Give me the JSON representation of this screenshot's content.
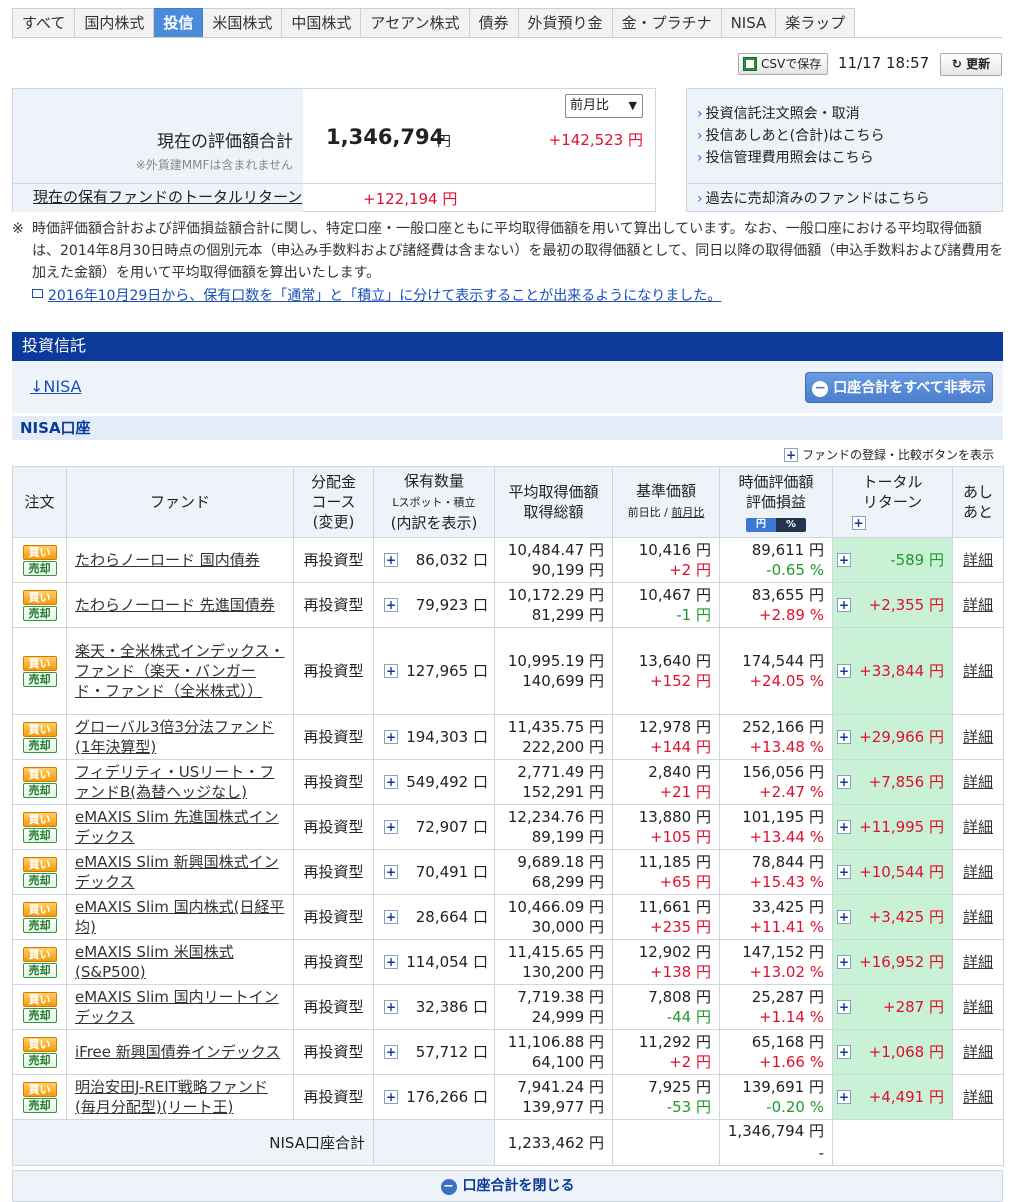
{
  "tabs": [
    "すべて",
    "国内株式",
    "投信",
    "米国株式",
    "中国株式",
    "アセアン株式",
    "債券",
    "外貨預り金",
    "金・プラチナ",
    "NISA",
    "楽ラップ"
  ],
  "active_tab": 2,
  "toolbar": {
    "csv_label": "CSVで保存",
    "datetime": "11/17 18:57",
    "refresh_label": "更新"
  },
  "summary": {
    "label": "現在の評価額合計",
    "note": "※外貨建MMFは含まれません",
    "value": "1,346,794",
    "unit": "円",
    "compare_select": "前月比",
    "diff": "+142,523 円",
    "total_return_label": "現在の保有ファンドのトータルリターン",
    "total_return_value": "+122,194 円"
  },
  "links": [
    "投資信託注文照会・取消",
    "投信あしあと(合計)はこちら",
    "投信管理費用照会はこちら",
    "過去に売却済みのファンドはこちら"
  ],
  "note": {
    "mark": "※",
    "text": "時価評価額合計および評価損益額合計に関し、特定口座・一般口座ともに平均取得価額を用いて算出しています。なお、一般口座における平均取得価額は、2014年8月30日時点の個別元本（申込み手数料および諸経費は含まない）を最初の取得価額として、同日以降の取得価額（申込手数料および諸費用を加えた金額）を用いて平均取得価額を算出いたします。",
    "link": "2016年10月29日から、保有口数を「通常」と「積立」に分けて表示することが出来るようになりました。"
  },
  "section_title": "投資信託",
  "nisa_link": "↓NISA",
  "hide_all_label": "口座合計をすべて非表示",
  "account_header": "NISA口座",
  "register_label": "ファンドの登録・比較ボタンを表示",
  "table": {
    "headers": {
      "order": "注文",
      "fund": "ファンド",
      "course1": "分配金",
      "course2": "コース",
      "course3": "(変更)",
      "qty1": "保有数量",
      "qty2": "Lスポット・積立",
      "qty3": "(内訳を表示)",
      "avg1": "平均取得価額",
      "avg2": "取得総額",
      "base1": "基準価額",
      "base2": "前日比 / ",
      "base3": "前月比",
      "val1": "時価評価額",
      "val2": "評価損益",
      "pill_yen": "円",
      "pill_pct": "%",
      "tr1": "トータル",
      "tr2": "リターン",
      "ashi1": "あし",
      "ashi2": "あと"
    },
    "buy_label": "買い",
    "sell_label": "売却",
    "detail_label": "詳細",
    "rows": [
      {
        "fund": "たわらノーロード 国内債券",
        "course": "再投資型",
        "qty": "86,032 口",
        "avg": "10,484.47 円",
        "cost": "90,199 円",
        "base": "10,416 円",
        "base_diff": "+2 円",
        "val": "89,611 円",
        "pl": "-0.65 %",
        "tr": "-589 円"
      },
      {
        "fund": "たわらノーロード 先進国債券",
        "course": "再投資型",
        "qty": "79,923 口",
        "avg": "10,172.29 円",
        "cost": "81,299 円",
        "base": "10,467 円",
        "base_diff": "-1 円",
        "val": "83,655 円",
        "pl": "+2.89 %",
        "tr": "+2,355 円"
      },
      {
        "fund": "楽天・全米株式インデックス・ファンド（楽天・バンガード・ファンド（全米株式））",
        "course": "再投資型",
        "qty": "127,965 口",
        "avg": "10,995.19 円",
        "cost": "140,699 円",
        "base": "13,640 円",
        "base_diff": "+152 円",
        "val": "174,544 円",
        "pl": "+24.05 %",
        "tr": "+33,844 円"
      },
      {
        "fund": "グローバル3倍3分法ファンド(1年決算型)",
        "course": "再投資型",
        "qty": "194,303 口",
        "avg": "11,435.75 円",
        "cost": "222,200 円",
        "base": "12,978 円",
        "base_diff": "+144 円",
        "val": "252,166 円",
        "pl": "+13.48 %",
        "tr": "+29,966 円"
      },
      {
        "fund": "フィデリティ・USリート・ファンドB(為替ヘッジなし)",
        "course": "再投資型",
        "qty": "549,492 口",
        "avg": "2,771.49 円",
        "cost": "152,291 円",
        "base": "2,840 円",
        "base_diff": "+21 円",
        "val": "156,056 円",
        "pl": "+2.47 %",
        "tr": "+7,856 円"
      },
      {
        "fund": "eMAXIS Slim 先進国株式インデックス",
        "course": "再投資型",
        "qty": "72,907 口",
        "avg": "12,234.76 円",
        "cost": "89,199 円",
        "base": "13,880 円",
        "base_diff": "+105 円",
        "val": "101,195 円",
        "pl": "+13.44 %",
        "tr": "+11,995 円"
      },
      {
        "fund": "eMAXIS Slim 新興国株式インデックス",
        "course": "再投資型",
        "qty": "70,491 口",
        "avg": "9,689.18 円",
        "cost": "68,299 円",
        "base": "11,185 円",
        "base_diff": "+65 円",
        "val": "78,844 円",
        "pl": "+15.43 %",
        "tr": "+10,544 円"
      },
      {
        "fund": "eMAXIS Slim 国内株式(日経平均)",
        "course": "再投資型",
        "qty": "28,664 口",
        "avg": "10,466.09 円",
        "cost": "30,000 円",
        "base": "11,661 円",
        "base_diff": "+235 円",
        "val": "33,425 円",
        "pl": "+11.41 %",
        "tr": "+3,425 円"
      },
      {
        "fund": "eMAXIS Slim 米国株式(S&P500)",
        "course": "再投資型",
        "qty": "114,054 口",
        "avg": "11,415.65 円",
        "cost": "130,200 円",
        "base": "12,902 円",
        "base_diff": "+138 円",
        "val": "147,152 円",
        "pl": "+13.02 %",
        "tr": "+16,952 円"
      },
      {
        "fund": "eMAXIS Slim 国内リートインデックス",
        "course": "再投資型",
        "qty": "32,386 口",
        "avg": "7,719.38 円",
        "cost": "24,999 円",
        "base": "7,808 円",
        "base_diff": "-44 円",
        "val": "25,287 円",
        "pl": "+1.14 %",
        "tr": "+287 円"
      },
      {
        "fund": "iFree 新興国債券インデックス",
        "course": "再投資型",
        "qty": "57,712 口",
        "avg": "11,106.88 円",
        "cost": "64,100 円",
        "base": "11,292 円",
        "base_diff": "+2 円",
        "val": "65,168 円",
        "pl": "+1.66 %",
        "tr": "+1,068 円"
      },
      {
        "fund": "明治安田J-REIT戦略ファンド(毎月分配型)(リート王)",
        "course": "再投資型",
        "qty": "176,266 口",
        "avg": "7,941.24 円",
        "cost": "139,977 円",
        "base": "7,925 円",
        "base_diff": "-53 円",
        "val": "139,691 円",
        "pl": "-0.20 %",
        "tr": "+4,491 円"
      }
    ],
    "total_label": "NISA口座合計",
    "total_cost": "1,233,462 円",
    "total_val": "1,346,794 円",
    "total_pl": "-"
  },
  "close_label": "口座合計を閉じる",
  "colors": {
    "accent": "#0a3a9a",
    "positive": "#e0102f",
    "negative": "#1f9a2b",
    "tr_bg": "#c9f1d6"
  }
}
